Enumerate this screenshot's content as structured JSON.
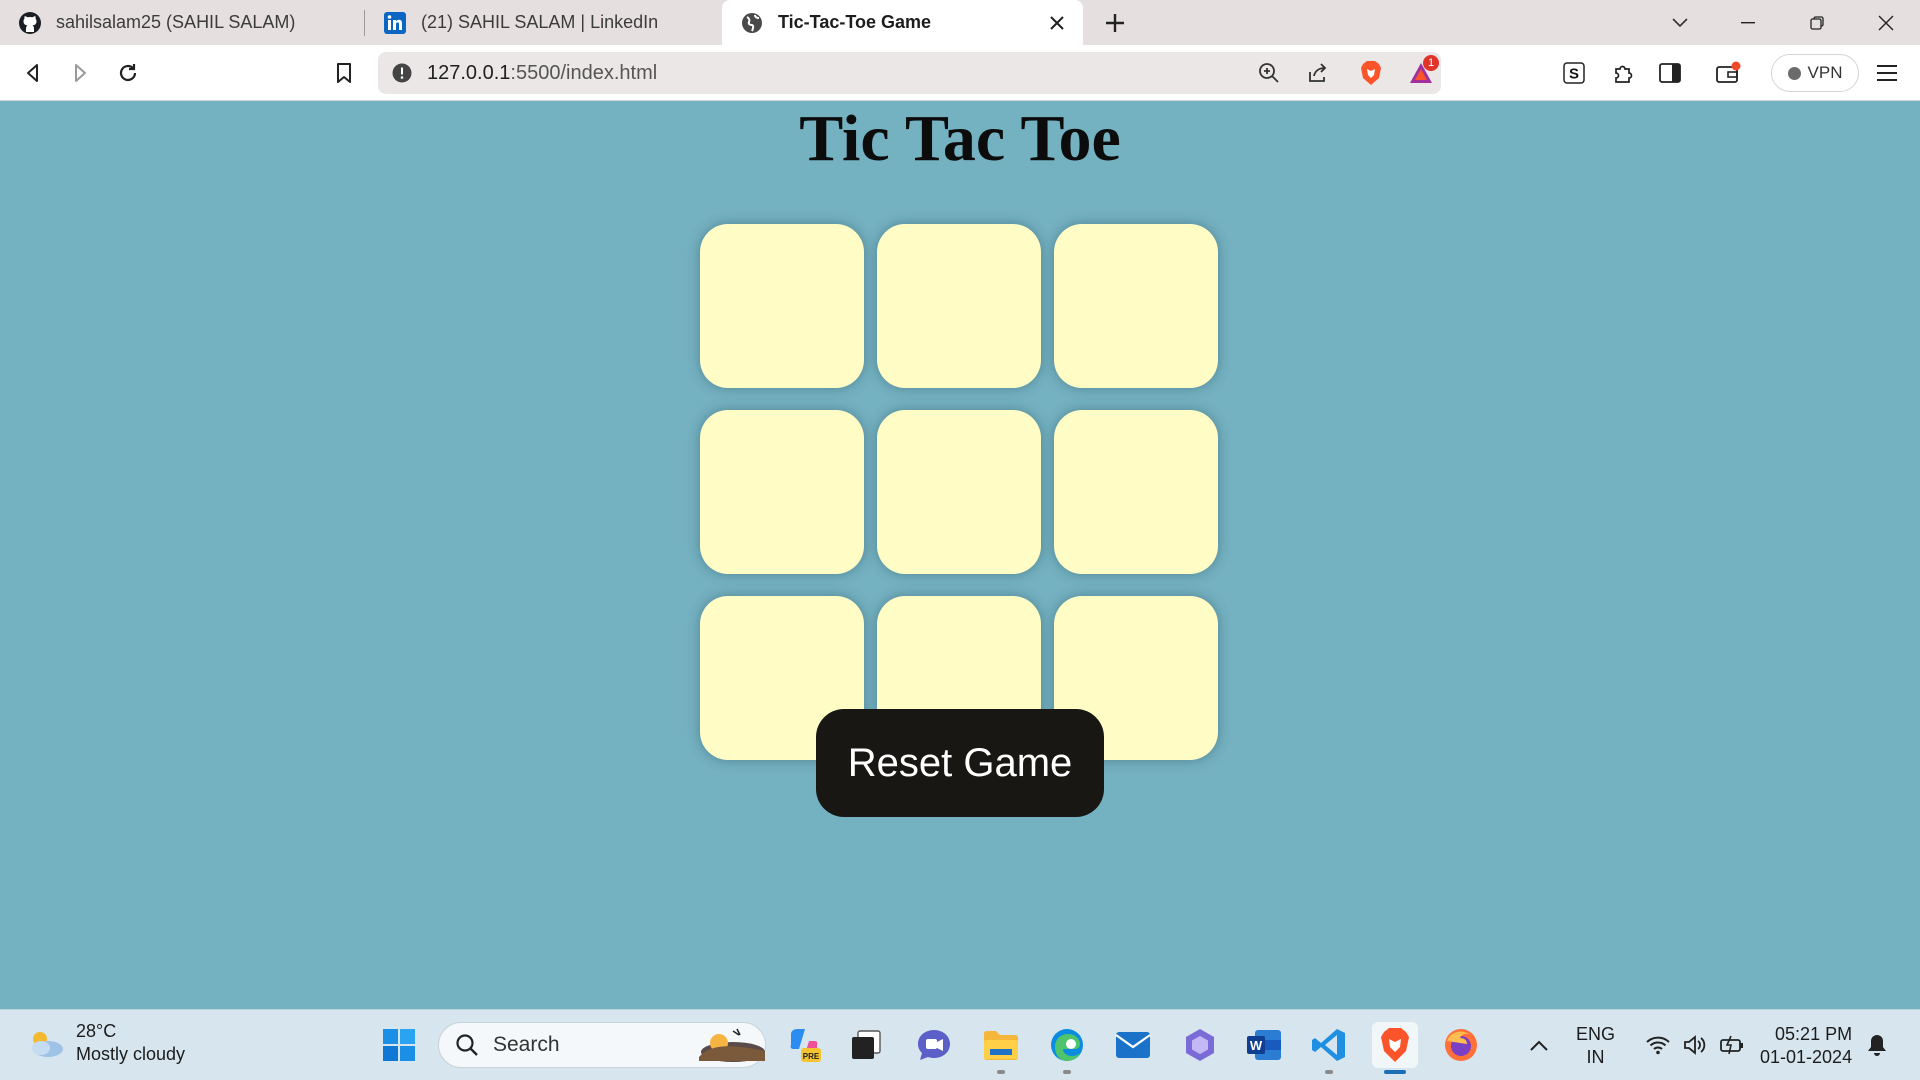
{
  "browser": {
    "tabs": [
      {
        "title": "sahilsalam25 (SAHIL SALAM)",
        "icon": "github-icon",
        "active": false
      },
      {
        "title": "(21) SAHIL SALAM | LinkedIn",
        "icon": "linkedin-icon",
        "active": false
      },
      {
        "title": "Tic-Tac-Toe Game",
        "icon": "globe-icon",
        "active": true
      }
    ],
    "address_bar": {
      "host": "127.0.0.1",
      "path": ":5500/index.html"
    },
    "brave_rewards_badge": "1",
    "vpn_label": "VPN"
  },
  "page": {
    "title": "Tic Tac Toe",
    "cells": [
      "",
      "",
      "",
      "",
      "",
      "",
      "",
      "",
      ""
    ],
    "reset_label": "Reset Game",
    "colors": {
      "background": "#74b1c1",
      "cell": "#fffdc5",
      "button": "#181713"
    }
  },
  "taskbar": {
    "weather": {
      "temp": "28°C",
      "desc": "Mostly cloudy"
    },
    "search_label": "Search",
    "lang": {
      "line1": "ENG",
      "line2": "IN"
    },
    "time": "05:21 PM",
    "date": "01-01-2024"
  }
}
